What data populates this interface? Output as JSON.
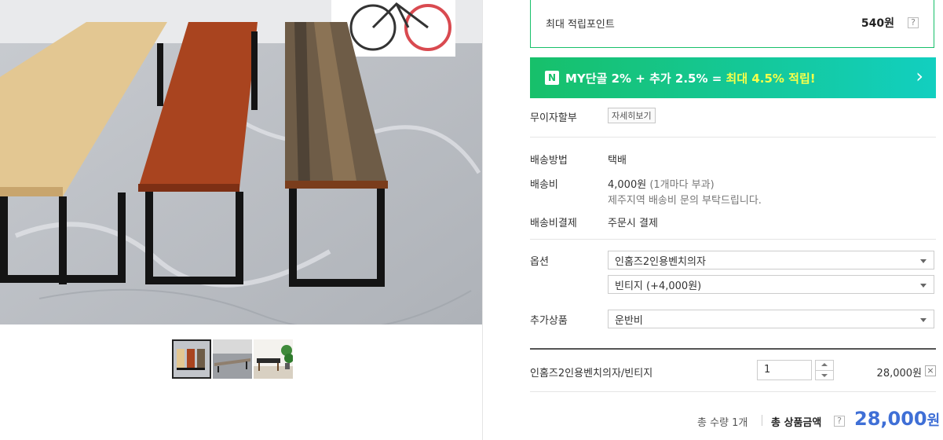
{
  "points": {
    "label": "최대 적립포인트",
    "value": "540원",
    "help": "?"
  },
  "naver_banner": {
    "badge": "N",
    "text_prefix": "MY단골 2% + 추가 2.5% = ",
    "text_highlight": "최대 4.5% 적립!",
    "chevron": "›",
    "bg_start": "#17c06a",
    "bg_end": "#12cfc0",
    "highlight_color": "#f6ff4a"
  },
  "installment": {
    "label": "무이자할부",
    "button": "자세히보기"
  },
  "shipping": {
    "method_label": "배송방법",
    "method_value": "택배",
    "fee_label": "배송비",
    "fee_value": "4,000원",
    "fee_note": "(1개마다 부과)",
    "fee_extra": "제주지역 배송비 문의 부탁드립니다.",
    "payment_label": "배송비결제",
    "payment_value": "주문시 결제"
  },
  "options": {
    "label": "옵션",
    "select1": "인홈즈2인용벤치의자",
    "select2": "빈티지 (+4,000원)"
  },
  "extra": {
    "label": "추가상품",
    "select": "운반비"
  },
  "selected_item": {
    "name": "인홈즈2인용벤치의자/빈티지",
    "qty": "1",
    "price": "28,000원",
    "remove": "×"
  },
  "total": {
    "qty_label": "총 수량 1개",
    "amount_label": "총 상품금액",
    "help": "?",
    "amount_value": "28,000",
    "amount_unit": "원",
    "amount_color": "#3f6fd6"
  },
  "images": {
    "main": "bench-photo",
    "thumbnails": [
      "thumb-three-benches",
      "thumb-bench-gray",
      "thumb-bench-plant"
    ]
  }
}
